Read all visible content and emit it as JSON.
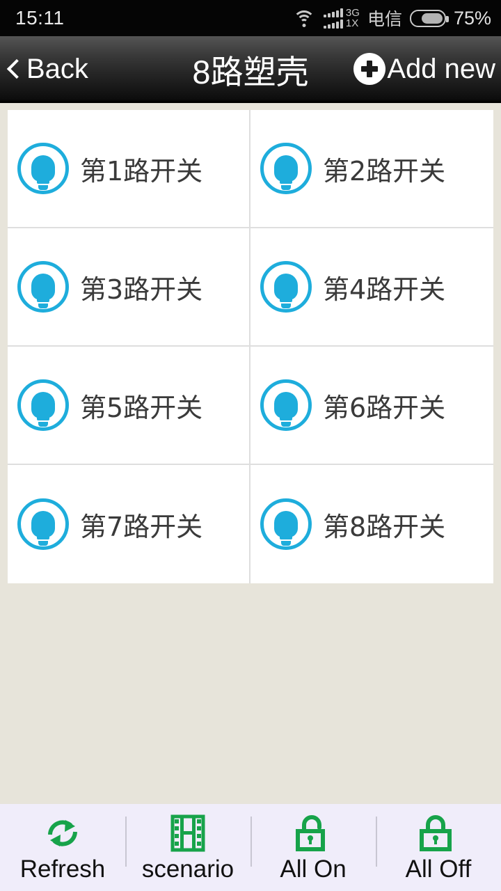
{
  "status_bar": {
    "time": "15:11",
    "wifi_icon": "wifi-icon",
    "signal_3g_label": "3G",
    "signal_1x_label": "1X",
    "carrier": "电信",
    "battery_icon": "battery-icon",
    "battery_percent": "75%"
  },
  "nav": {
    "back_label": "Back",
    "back_icon": "chevron-left-icon",
    "title": "8路塑壳",
    "add_icon": "plus-circle-icon",
    "add_label": "Add new"
  },
  "grid": {
    "icon_name": "light-bulb-icon",
    "accent_color": "#1EADDC",
    "items": [
      {
        "label": "第1路开关"
      },
      {
        "label": "第2路开关"
      },
      {
        "label": "第3路开关"
      },
      {
        "label": "第4路开关"
      },
      {
        "label": "第5路开关"
      },
      {
        "label": "第6路开关"
      },
      {
        "label": "第7路开关"
      },
      {
        "label": "第8路开关"
      }
    ]
  },
  "toolbar": {
    "icon_color": "#17A34A",
    "items": [
      {
        "label": "Refresh",
        "icon": "refresh-icon"
      },
      {
        "label": "scenario",
        "icon": "film-strip-icon"
      },
      {
        "label": "All On",
        "icon": "unlocked-padlock-icon"
      },
      {
        "label": "All Off",
        "icon": "locked-padlock-icon"
      }
    ]
  },
  "colors": {
    "page_background": "#E7E4DA",
    "cell_background": "#FFFFFF",
    "toolbar_background": "#F0EDFA",
    "navbar_top": "#555555",
    "navbar_bottom": "#000000"
  }
}
